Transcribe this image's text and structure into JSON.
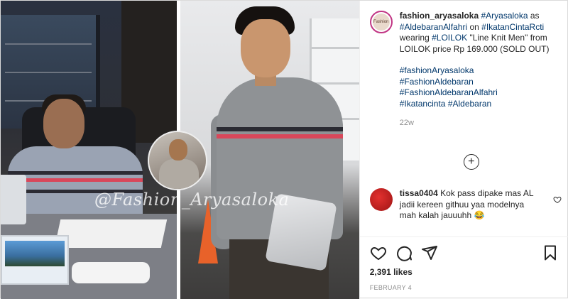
{
  "post": {
    "watermark": "@Fashion_Aryasaloka",
    "avatar_text": "Fashion",
    "username": "fashion_aryasaloka",
    "caption_segments": [
      {
        "text": "#Aryasaloka",
        "kind": "tag"
      },
      {
        "text": " as ",
        "kind": "plain"
      },
      {
        "text": "#AldebaranAlfahri",
        "kind": "tag"
      },
      {
        "text": " on ",
        "kind": "plain"
      },
      {
        "text": "#IkatanCintaRcti",
        "kind": "tag"
      },
      {
        "text": " wearing ",
        "kind": "plain"
      },
      {
        "text": "#LOILOK",
        "kind": "tag"
      },
      {
        "text": " \"Line Knit Men\" from LOILOK price Rp 169.000 (SOLD OUT)",
        "kind": "plain"
      }
    ],
    "hashtags": [
      "#fashionAryasaloka",
      "#FashionAldebaran",
      "#FashionAldebaranAlfahri",
      "#Ikatancinta",
      "#Aldebaran"
    ],
    "time_ago": "22w",
    "load_more_icon": "plus-circle-icon",
    "comment": {
      "username": "tissa0404",
      "text": "Kok pass dipake mas AL jadii kereen githuu yaa modelnya mah kalah jauuuhh",
      "emoji": "😂"
    },
    "likes": "2,391 likes",
    "date": "FEBRUARY 4"
  },
  "colors": {
    "link": "#00376b",
    "stripe_red": "#d9475a",
    "stripe_dark": "#2b2b33"
  }
}
